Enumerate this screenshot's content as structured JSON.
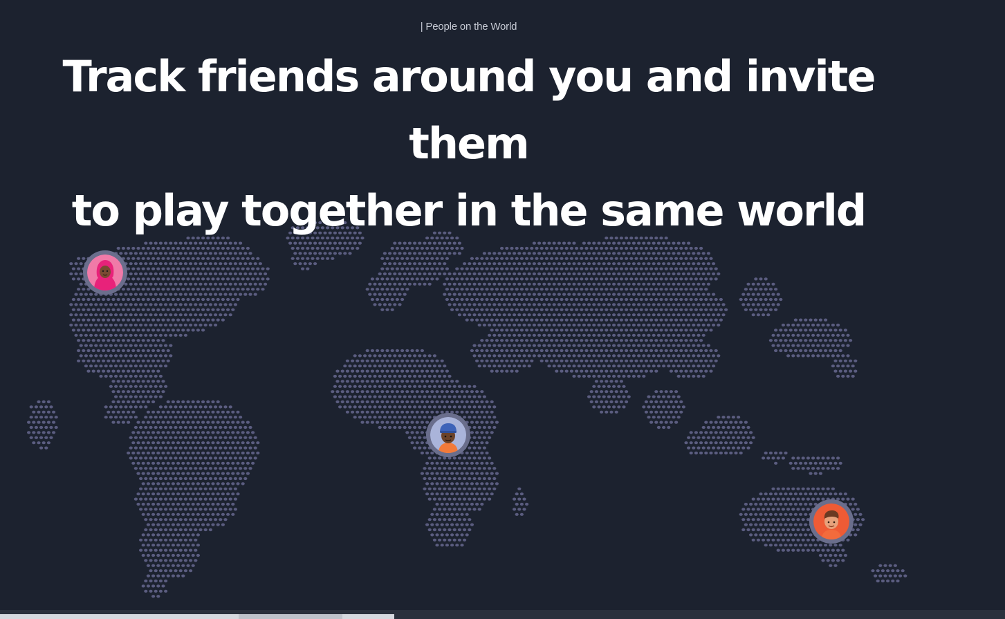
{
  "section": {
    "eyebrow": "| People on the World",
    "headline_line1": "Track friends around you and invite them",
    "headline_line2": "to play together in the same world"
  },
  "colors": {
    "background": "#1c222f",
    "map_dot": "#5b5d80",
    "headline": "#ffffff",
    "eyebrow": "#c8ccd6",
    "avatar_ring": "#6a6e8c"
  },
  "avatars": [
    {
      "icon": "girl-hijab-avatar-icon",
      "background": "#ef6fa1"
    },
    {
      "icon": "boy-cap-avatar-icon",
      "background": "#a9b3d8"
    },
    {
      "icon": "man-orange-avatar-icon",
      "background": "#ee5b35"
    }
  ]
}
